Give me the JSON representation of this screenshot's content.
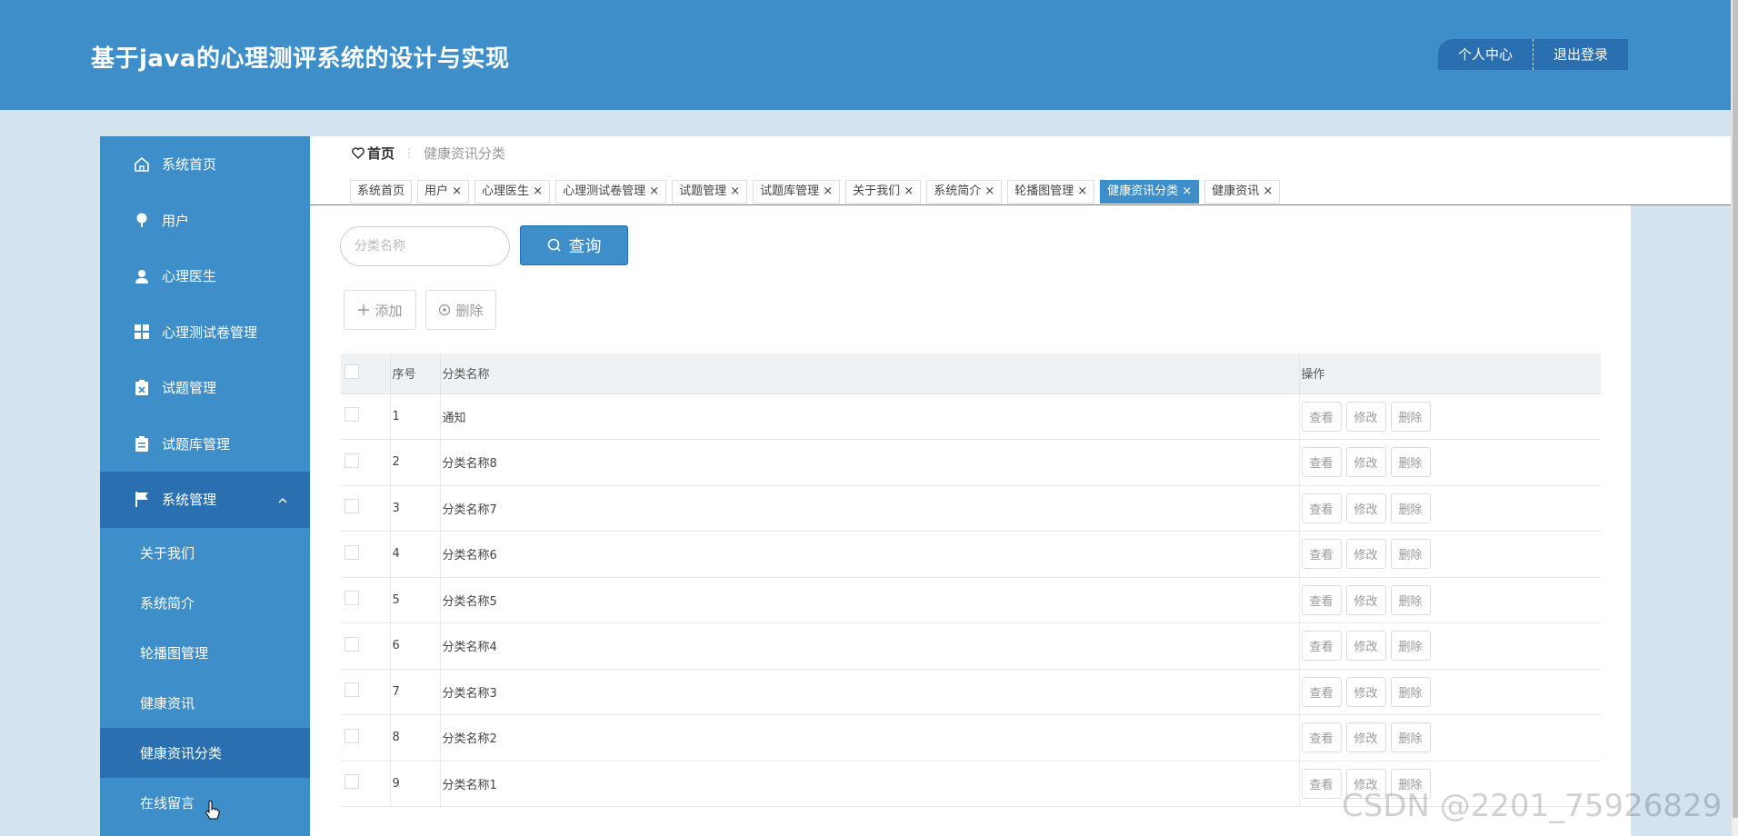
{
  "header": {
    "title": "基于java的心理测评系统的设计与实现",
    "profile_label": "个人中心",
    "logout_label": "退出登录"
  },
  "sidebar": {
    "items": [
      {
        "label": "系统首页",
        "icon": "home-icon"
      },
      {
        "label": "用户",
        "icon": "pin-icon"
      },
      {
        "label": "心理医生",
        "icon": "user-icon"
      },
      {
        "label": "心理测试卷管理",
        "icon": "grid-icon"
      },
      {
        "label": "试题管理",
        "icon": "clipboard-x-icon"
      },
      {
        "label": "试题库管理",
        "icon": "clipboard-icon"
      },
      {
        "label": "系统管理",
        "icon": "flag-icon"
      }
    ],
    "sub_items": [
      {
        "label": "关于我们"
      },
      {
        "label": "系统简介"
      },
      {
        "label": "轮播图管理"
      },
      {
        "label": "健康资讯"
      },
      {
        "label": "健康资讯分类",
        "active": true
      },
      {
        "label": "在线留言"
      }
    ]
  },
  "breadcrumb": {
    "home": "首页",
    "current": "健康资讯分类"
  },
  "tabs": [
    {
      "label": "系统首页"
    },
    {
      "label": "用户 ×"
    },
    {
      "label": "心理医生 ×"
    },
    {
      "label": "心理测试卷管理 ×"
    },
    {
      "label": "试题管理 ×"
    },
    {
      "label": "试题库管理 ×"
    },
    {
      "label": "关于我们 ×"
    },
    {
      "label": "系统简介 ×"
    },
    {
      "label": "轮播图管理 ×"
    },
    {
      "label": "健康资讯分类 ×",
      "active": true
    },
    {
      "label": "健康资讯 ×"
    }
  ],
  "search": {
    "placeholder": "分类名称",
    "button_label": "查询"
  },
  "toolbar": {
    "add_label": "添加",
    "delete_label": "删除"
  },
  "table": {
    "columns": [
      "序号",
      "分类名称",
      "操作"
    ],
    "rows": [
      {
        "no": "1",
        "name": "通知"
      },
      {
        "no": "2",
        "name": "分类名称8"
      },
      {
        "no": "3",
        "name": "分类名称7"
      },
      {
        "no": "4",
        "name": "分类名称6"
      },
      {
        "no": "5",
        "name": "分类名称5"
      },
      {
        "no": "6",
        "name": "分类名称4"
      },
      {
        "no": "7",
        "name": "分类名称3"
      },
      {
        "no": "8",
        "name": "分类名称2"
      },
      {
        "no": "9",
        "name": "分类名称1"
      }
    ],
    "ops": {
      "view": "查看",
      "edit": "修改",
      "delete": "删除"
    }
  },
  "watermark": "CSDN @2201_75926829",
  "colors": {
    "primary": "#3d8ec9",
    "primary_dark": "#2a6fb0",
    "page_bg": "#d3e3f0"
  }
}
